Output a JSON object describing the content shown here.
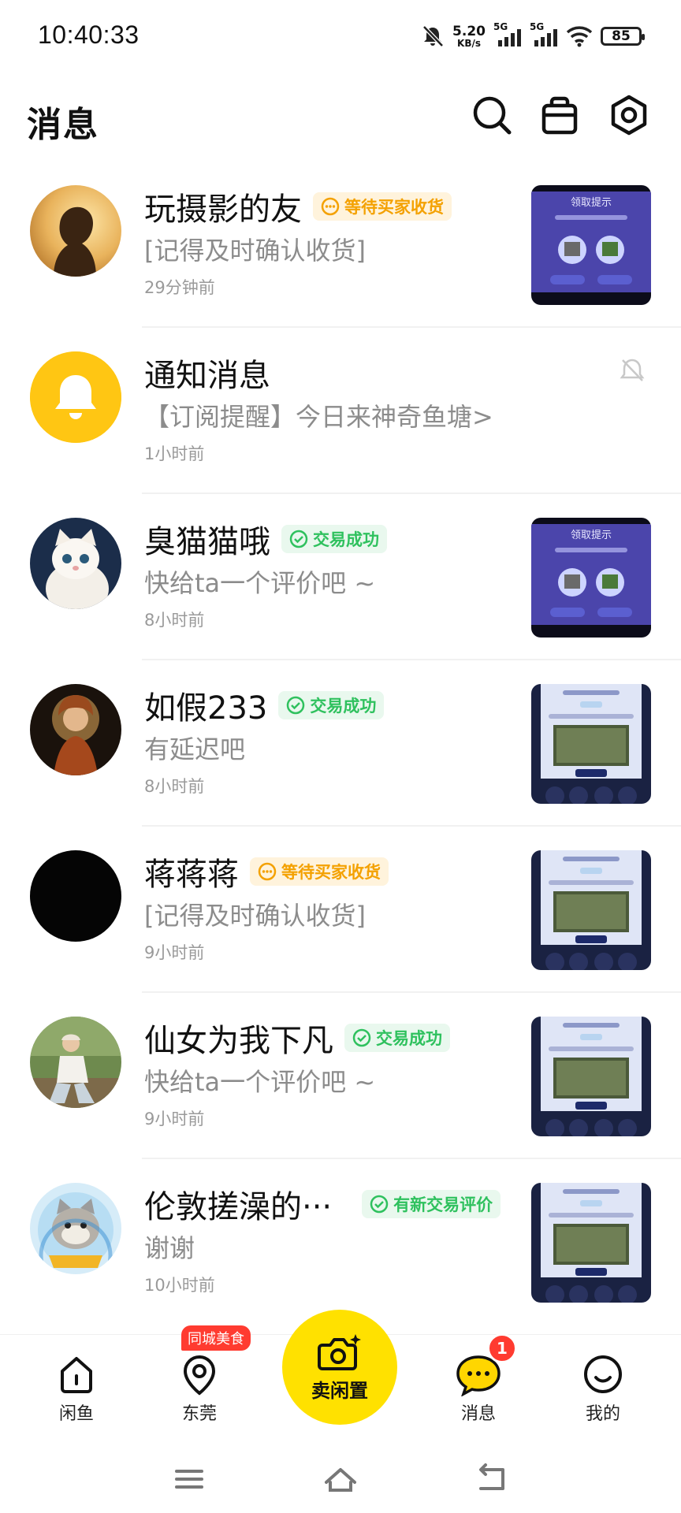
{
  "status_bar": {
    "time": "10:40:33",
    "net_speed_value": "5.20",
    "net_speed_unit": "KB/s",
    "signal_1_label": "5G",
    "signal_2_label": "5G",
    "battery_level": "85"
  },
  "header": {
    "title": "消息",
    "icons": [
      "search-icon",
      "shop-bag-icon",
      "settings-icon"
    ]
  },
  "conversations": [
    {
      "name": "玩摄影的友",
      "badge": "等待买家收货",
      "badge_type": "waiting",
      "preview": "[记得及时确认收货]",
      "time": "29分钟前",
      "thumb": "reward"
    },
    {
      "name": "通知消息",
      "badge": "",
      "badge_type": "none",
      "preview": "【订阅提醒】今日来神奇鱼塘>",
      "time": "1小时前",
      "thumb": "none",
      "muted": true
    },
    {
      "name": "臭猫猫哦",
      "badge": "交易成功",
      "badge_type": "success",
      "preview": "快给ta一个评价吧 ~",
      "time": "8小时前",
      "thumb": "reward"
    },
    {
      "name": "如假233",
      "badge": "交易成功",
      "badge_type": "success",
      "preview": "有延迟吧",
      "time": "8小时前",
      "thumb": "phone"
    },
    {
      "name": "蒋蒋蒋",
      "badge": "等待买家收货",
      "badge_type": "waiting",
      "preview": "[记得及时确认收货]",
      "time": "9小时前",
      "thumb": "phone"
    },
    {
      "name": "仙女为我下凡",
      "badge": "交易成功",
      "badge_type": "success",
      "preview": "快给ta一个评价吧 ~",
      "time": "9小时前",
      "thumb": "phone"
    },
    {
      "name": "伦敦搓澡的···",
      "badge": "有新交易评价",
      "badge_type": "success",
      "preview": "谢谢",
      "time": "10小时前",
      "thumb": "phone"
    }
  ],
  "thumb_text": {
    "reward_title": "领取提示"
  },
  "tabbar": {
    "home": "闲鱼",
    "local": "东莞",
    "local_promo": "同城美食",
    "sell": "卖闲置",
    "messages": "消息",
    "messages_unread": "1",
    "me": "我的"
  },
  "colors": {
    "brand_yellow": "#ffe100",
    "waiting_orange": "#f4a100",
    "success_green": "#2fc15e",
    "badge_red": "#ff3b30"
  }
}
